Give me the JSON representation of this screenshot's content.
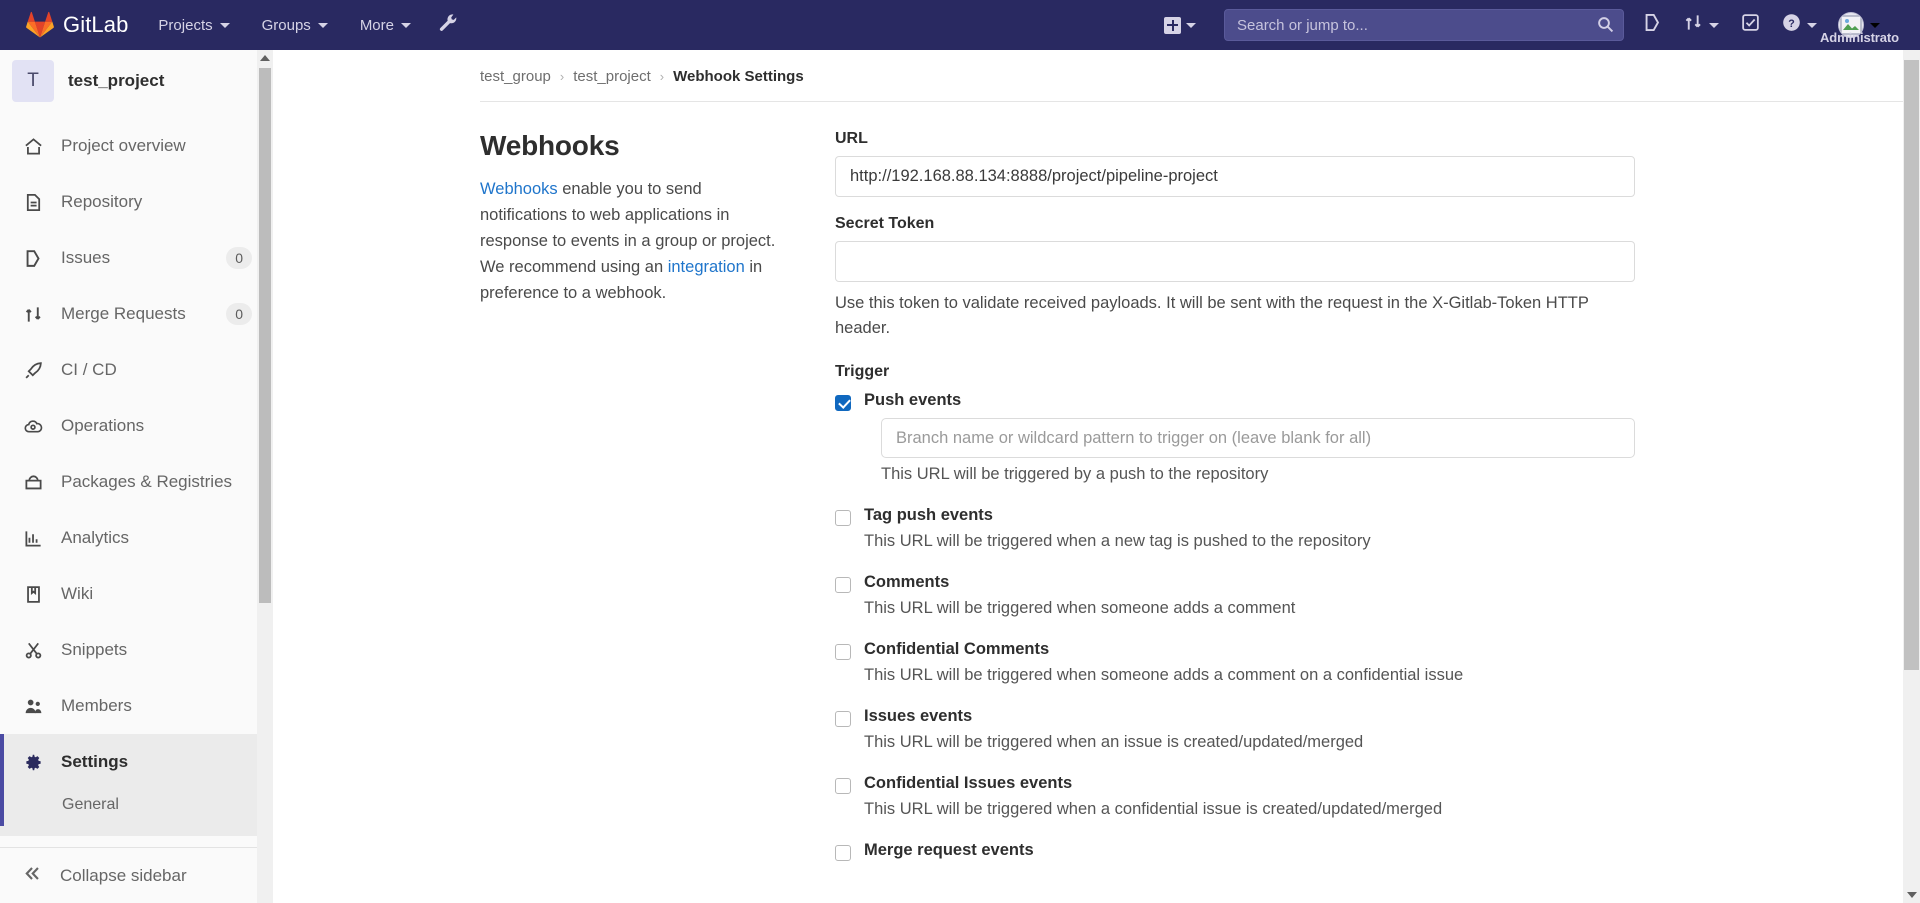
{
  "navbar": {
    "brand": "GitLab",
    "items": [
      {
        "label": "Projects",
        "icon": "chevron-down-icon"
      },
      {
        "label": "Groups",
        "icon": "chevron-down-icon"
      },
      {
        "label": "More",
        "icon": "chevron-down-icon"
      }
    ],
    "wrench_icon": "wrench-icon",
    "plus_icon": "plus-square-icon",
    "search": {
      "placeholder": "Search or jump to...",
      "value": "",
      "icon": "search-icon"
    },
    "right_icons": [
      {
        "name": "issues-icon"
      },
      {
        "name": "merge-requests-icon"
      },
      {
        "name": "todos-icon"
      },
      {
        "name": "help-icon"
      }
    ],
    "user": {
      "name": "Administrato",
      "avatar": "user-avatar"
    }
  },
  "sidebar": {
    "project": {
      "initial": "T",
      "name": "test_project"
    },
    "items": [
      {
        "label": "Project overview",
        "icon": "home-icon",
        "badge": ""
      },
      {
        "label": "Repository",
        "icon": "document-icon",
        "badge": ""
      },
      {
        "label": "Issues",
        "icon": "issues-icon",
        "badge": "0"
      },
      {
        "label": "Merge Requests",
        "icon": "merge-icon",
        "badge": "0"
      },
      {
        "label": "CI / CD",
        "icon": "rocket-icon",
        "badge": ""
      },
      {
        "label": "Operations",
        "icon": "cloud-gear-icon",
        "badge": ""
      },
      {
        "label": "Packages & Registries",
        "icon": "package-icon",
        "badge": ""
      },
      {
        "label": "Analytics",
        "icon": "chart-icon",
        "badge": ""
      },
      {
        "label": "Wiki",
        "icon": "book-icon",
        "badge": ""
      },
      {
        "label": "Snippets",
        "icon": "scissors-icon",
        "badge": ""
      },
      {
        "label": "Members",
        "icon": "users-icon",
        "badge": ""
      }
    ],
    "settings": {
      "label": "Settings",
      "icon": "gear-icon",
      "active": true
    },
    "settings_sub": [
      {
        "label": "General"
      }
    ],
    "collapse": {
      "label": "Collapse sidebar",
      "icon": "chevron-double-left-icon"
    }
  },
  "breadcrumb": {
    "group": "test_group",
    "project": "test_project",
    "current": "Webhook Settings",
    "separator": "›"
  },
  "section": {
    "title": "Webhooks",
    "desc_link1": "Webhooks",
    "desc_part1": " enable you to send notifications to web applications in response to events in a group or project. We recommend using an ",
    "desc_link2": "integration",
    "desc_part2": " in preference to a webhook."
  },
  "form": {
    "url": {
      "label": "URL",
      "value": "http://192.168.88.134:8888/project/pipeline-project",
      "placeholder": ""
    },
    "secret_token": {
      "label": "Secret Token",
      "value": "",
      "placeholder": ""
    },
    "secret_help": "Use this token to validate received payloads. It will be sent with the request in the X-Gitlab-Token HTTP header.",
    "trigger_label": "Trigger",
    "triggers": [
      {
        "title": "Push events",
        "checked": true,
        "input": {
          "placeholder": "Branch name or wildcard pattern to trigger on (leave blank for all)",
          "value": ""
        },
        "desc": "This URL will be triggered by a push to the repository"
      },
      {
        "title": "Tag push events",
        "checked": false,
        "desc": "This URL will be triggered when a new tag is pushed to the repository"
      },
      {
        "title": "Comments",
        "checked": false,
        "desc": "This URL will be triggered when someone adds a comment"
      },
      {
        "title": "Confidential Comments",
        "checked": false,
        "desc": "This URL will be triggered when someone adds a comment on a confidential issue"
      },
      {
        "title": "Issues events",
        "checked": false,
        "desc": "This URL will be triggered when an issue is created/updated/merged"
      },
      {
        "title": "Confidential Issues events",
        "checked": false,
        "desc": "This URL will be triggered when a confidential issue is created/updated/merged"
      },
      {
        "title": "Merge request events",
        "checked": false,
        "desc": ""
      }
    ]
  },
  "colors": {
    "navbar_bg": "#292961",
    "accent": "#1068bf",
    "link": "#1f75cb",
    "active_bar": "#4b4ba3"
  }
}
